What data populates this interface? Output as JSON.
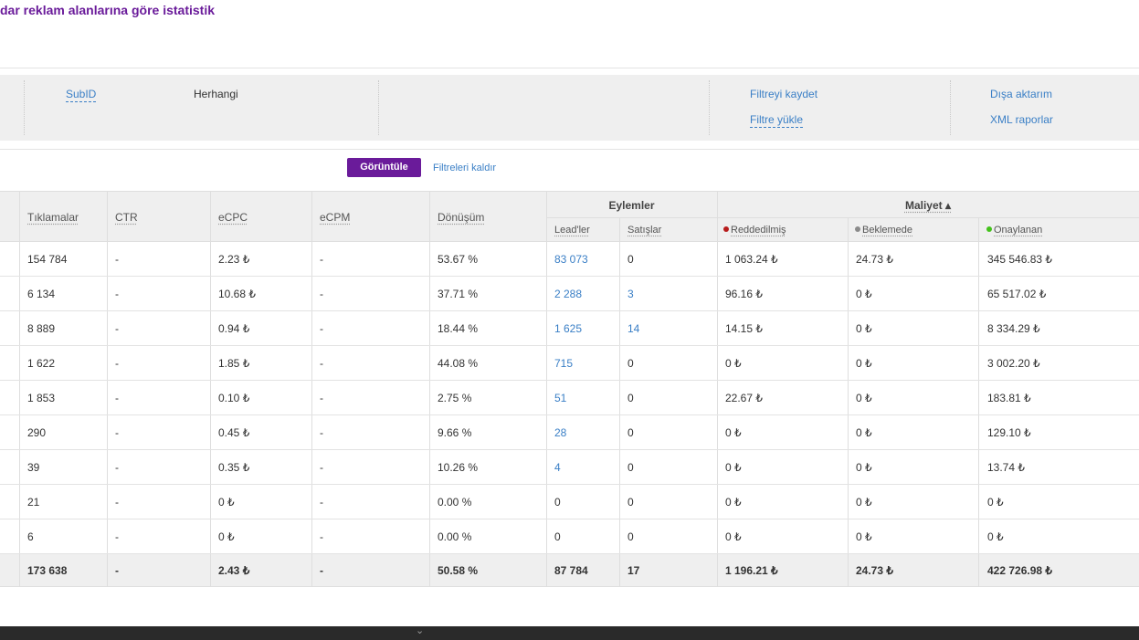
{
  "page": {
    "title": "dar reklam alanlarına göre istatistik"
  },
  "filters": {
    "subid_label": "SubID",
    "subid_value": "Herhangi",
    "save_filter": "Filtreyi kaydet",
    "load_filter": "Filtre yükle",
    "export": "Dışa aktarım",
    "xml_reports": "XML raporlar",
    "show_button": "Görüntüle",
    "clear_filters": "Filtreleri kaldır"
  },
  "table": {
    "headers": {
      "clicks": "Tıklamalar",
      "ctr": "CTR",
      "ecpc": "eCPC",
      "ecpm": "eCPM",
      "conversion": "Dönüşüm",
      "actions_group": "Eylemler",
      "leads": "Lead'ler",
      "sales": "Satışlar",
      "cost_group": "Maliyet ▴",
      "rejected": "Reddedilmiş",
      "pending": "Beklemede",
      "approved": "Onaylanan"
    },
    "status_colors": {
      "rejected": "#b71c1c",
      "pending": "#8a8a8a",
      "approved": "#43c21b"
    },
    "rows": [
      {
        "clicks": "154 784",
        "ctr": "-",
        "ecpc": "2.23 ₺",
        "ecpm": "-",
        "conversion": "53.67 %",
        "leads": "83 073",
        "sales": "0",
        "rejected": "1 063.24 ₺",
        "pending": "24.73 ₺",
        "approved": "345 546.83 ₺"
      },
      {
        "clicks": "6 134",
        "ctr": "-",
        "ecpc": "10.68 ₺",
        "ecpm": "-",
        "conversion": "37.71 %",
        "leads": "2 288",
        "sales": "3",
        "rejected": "96.16 ₺",
        "pending": "0 ₺",
        "approved": "65 517.02 ₺"
      },
      {
        "clicks": "8 889",
        "ctr": "-",
        "ecpc": "0.94 ₺",
        "ecpm": "-",
        "conversion": "18.44 %",
        "leads": "1 625",
        "sales": "14",
        "rejected": "14.15 ₺",
        "pending": "0 ₺",
        "approved": "8 334.29 ₺"
      },
      {
        "clicks": "1 622",
        "ctr": "-",
        "ecpc": "1.85 ₺",
        "ecpm": "-",
        "conversion": "44.08 %",
        "leads": "715",
        "sales": "0",
        "rejected": "0 ₺",
        "pending": "0 ₺",
        "approved": "3 002.20 ₺"
      },
      {
        "clicks": "1 853",
        "ctr": "-",
        "ecpc": "0.10 ₺",
        "ecpm": "-",
        "conversion": "2.75 %",
        "leads": "51",
        "sales": "0",
        "rejected": "22.67 ₺",
        "pending": "0 ₺",
        "approved": "183.81 ₺"
      },
      {
        "clicks": "290",
        "ctr": "-",
        "ecpc": "0.45 ₺",
        "ecpm": "-",
        "conversion": "9.66 %",
        "leads": "28",
        "sales": "0",
        "rejected": "0 ₺",
        "pending": "0 ₺",
        "approved": "129.10 ₺"
      },
      {
        "clicks": "39",
        "ctr": "-",
        "ecpc": "0.35 ₺",
        "ecpm": "-",
        "conversion": "10.26 %",
        "leads": "4",
        "sales": "0",
        "rejected": "0 ₺",
        "pending": "0 ₺",
        "approved": "13.74 ₺"
      },
      {
        "clicks": "21",
        "ctr": "-",
        "ecpc": "0 ₺",
        "ecpm": "-",
        "conversion": "0.00 %",
        "leads": "0",
        "sales": "0",
        "rejected": "0 ₺",
        "pending": "0 ₺",
        "approved": "0 ₺"
      },
      {
        "clicks": "6",
        "ctr": "-",
        "ecpc": "0 ₺",
        "ecpm": "-",
        "conversion": "0.00 %",
        "leads": "0",
        "sales": "0",
        "rejected": "0 ₺",
        "pending": "0 ₺",
        "approved": "0 ₺"
      }
    ],
    "total": {
      "clicks": "173 638",
      "ctr": "-",
      "ecpc": "2.43 ₺",
      "ecpm": "-",
      "conversion": "50.58 %",
      "leads": "87 784",
      "sales": "17",
      "rejected": "1 196.21 ₺",
      "pending": "24.73 ₺",
      "approved": "422 726.98 ₺"
    }
  }
}
